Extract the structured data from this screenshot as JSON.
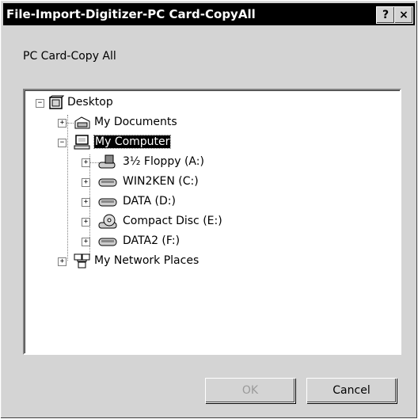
{
  "window": {
    "title": "File-Import-Digitizer-PC Card-CopyAll"
  },
  "titlebar": {
    "help_label": "?",
    "close_label": "×"
  },
  "dialog": {
    "caption": "PC Card-Copy All"
  },
  "tree": {
    "root": "Desktop",
    "items": [
      {
        "label": "My Documents"
      },
      {
        "label": "My Computer"
      },
      {
        "label": "3½ Floppy (A:)"
      },
      {
        "label": "WIN2KEN (C:)"
      },
      {
        "label": "DATA (D:)"
      },
      {
        "label": "Compact Disc (E:)"
      },
      {
        "label": "DATA2 (F:)"
      },
      {
        "label": "My Network Places"
      }
    ]
  },
  "buttons": {
    "ok_label": "OK",
    "cancel_label": "Cancel"
  },
  "colors": {
    "titlebar": "#000000",
    "dialog": "#d4d4d4",
    "tree_bg": "#ffffff"
  },
  "icons": [
    "desktop-icon",
    "my-documents-icon",
    "my-computer-icon",
    "floppy-drive-icon",
    "hard-drive-icon",
    "cd-drive-icon",
    "network-places-icon"
  ]
}
